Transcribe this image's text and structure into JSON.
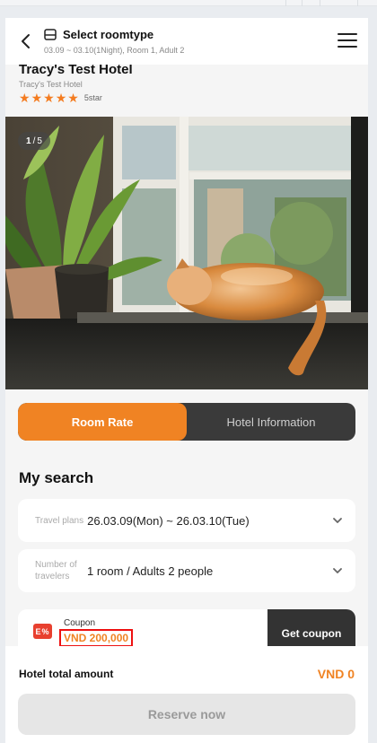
{
  "header": {
    "title": "Select roomtype",
    "subtitle": "03.09 ~ 03.10(1Night), Room 1, Adult 2"
  },
  "hotel": {
    "name": "Tracy's Test Hotel",
    "subname": "Tracy's Test Hotel",
    "stars": 5,
    "star_label": "5star"
  },
  "gallery": {
    "current": "1",
    "separator": "/",
    "total": "5"
  },
  "tabs": [
    {
      "label": "Room Rate",
      "active": true
    },
    {
      "label": "Hotel Information",
      "active": false
    }
  ],
  "search": {
    "title": "My search",
    "travel_plans_label": "Travel plans",
    "travel_plans_value": "26.03.09(Mon) ~ 26.03.10(Tue)",
    "travelers_label": "Number of travelers",
    "travelers_value": "1 room / Adults 2 people"
  },
  "coupon": {
    "icon_text": "E%",
    "label": "Coupon",
    "amount": "VND 200,000",
    "button": "Get coupon"
  },
  "footer": {
    "total_label": "Hotel total amount",
    "total_value": "VND 0",
    "reserve_button": "Reserve now"
  },
  "colors": {
    "accent": "#f08323",
    "dark": "#3a3a3a",
    "coupon_red": "#e8402f"
  },
  "icons": {
    "back": "chevron-left-icon",
    "room": "bed-icon",
    "menu": "hamburger-menu-icon",
    "star": "star-icon",
    "dropdown": "chevron-down-icon",
    "coupon": "coupon-icon"
  }
}
